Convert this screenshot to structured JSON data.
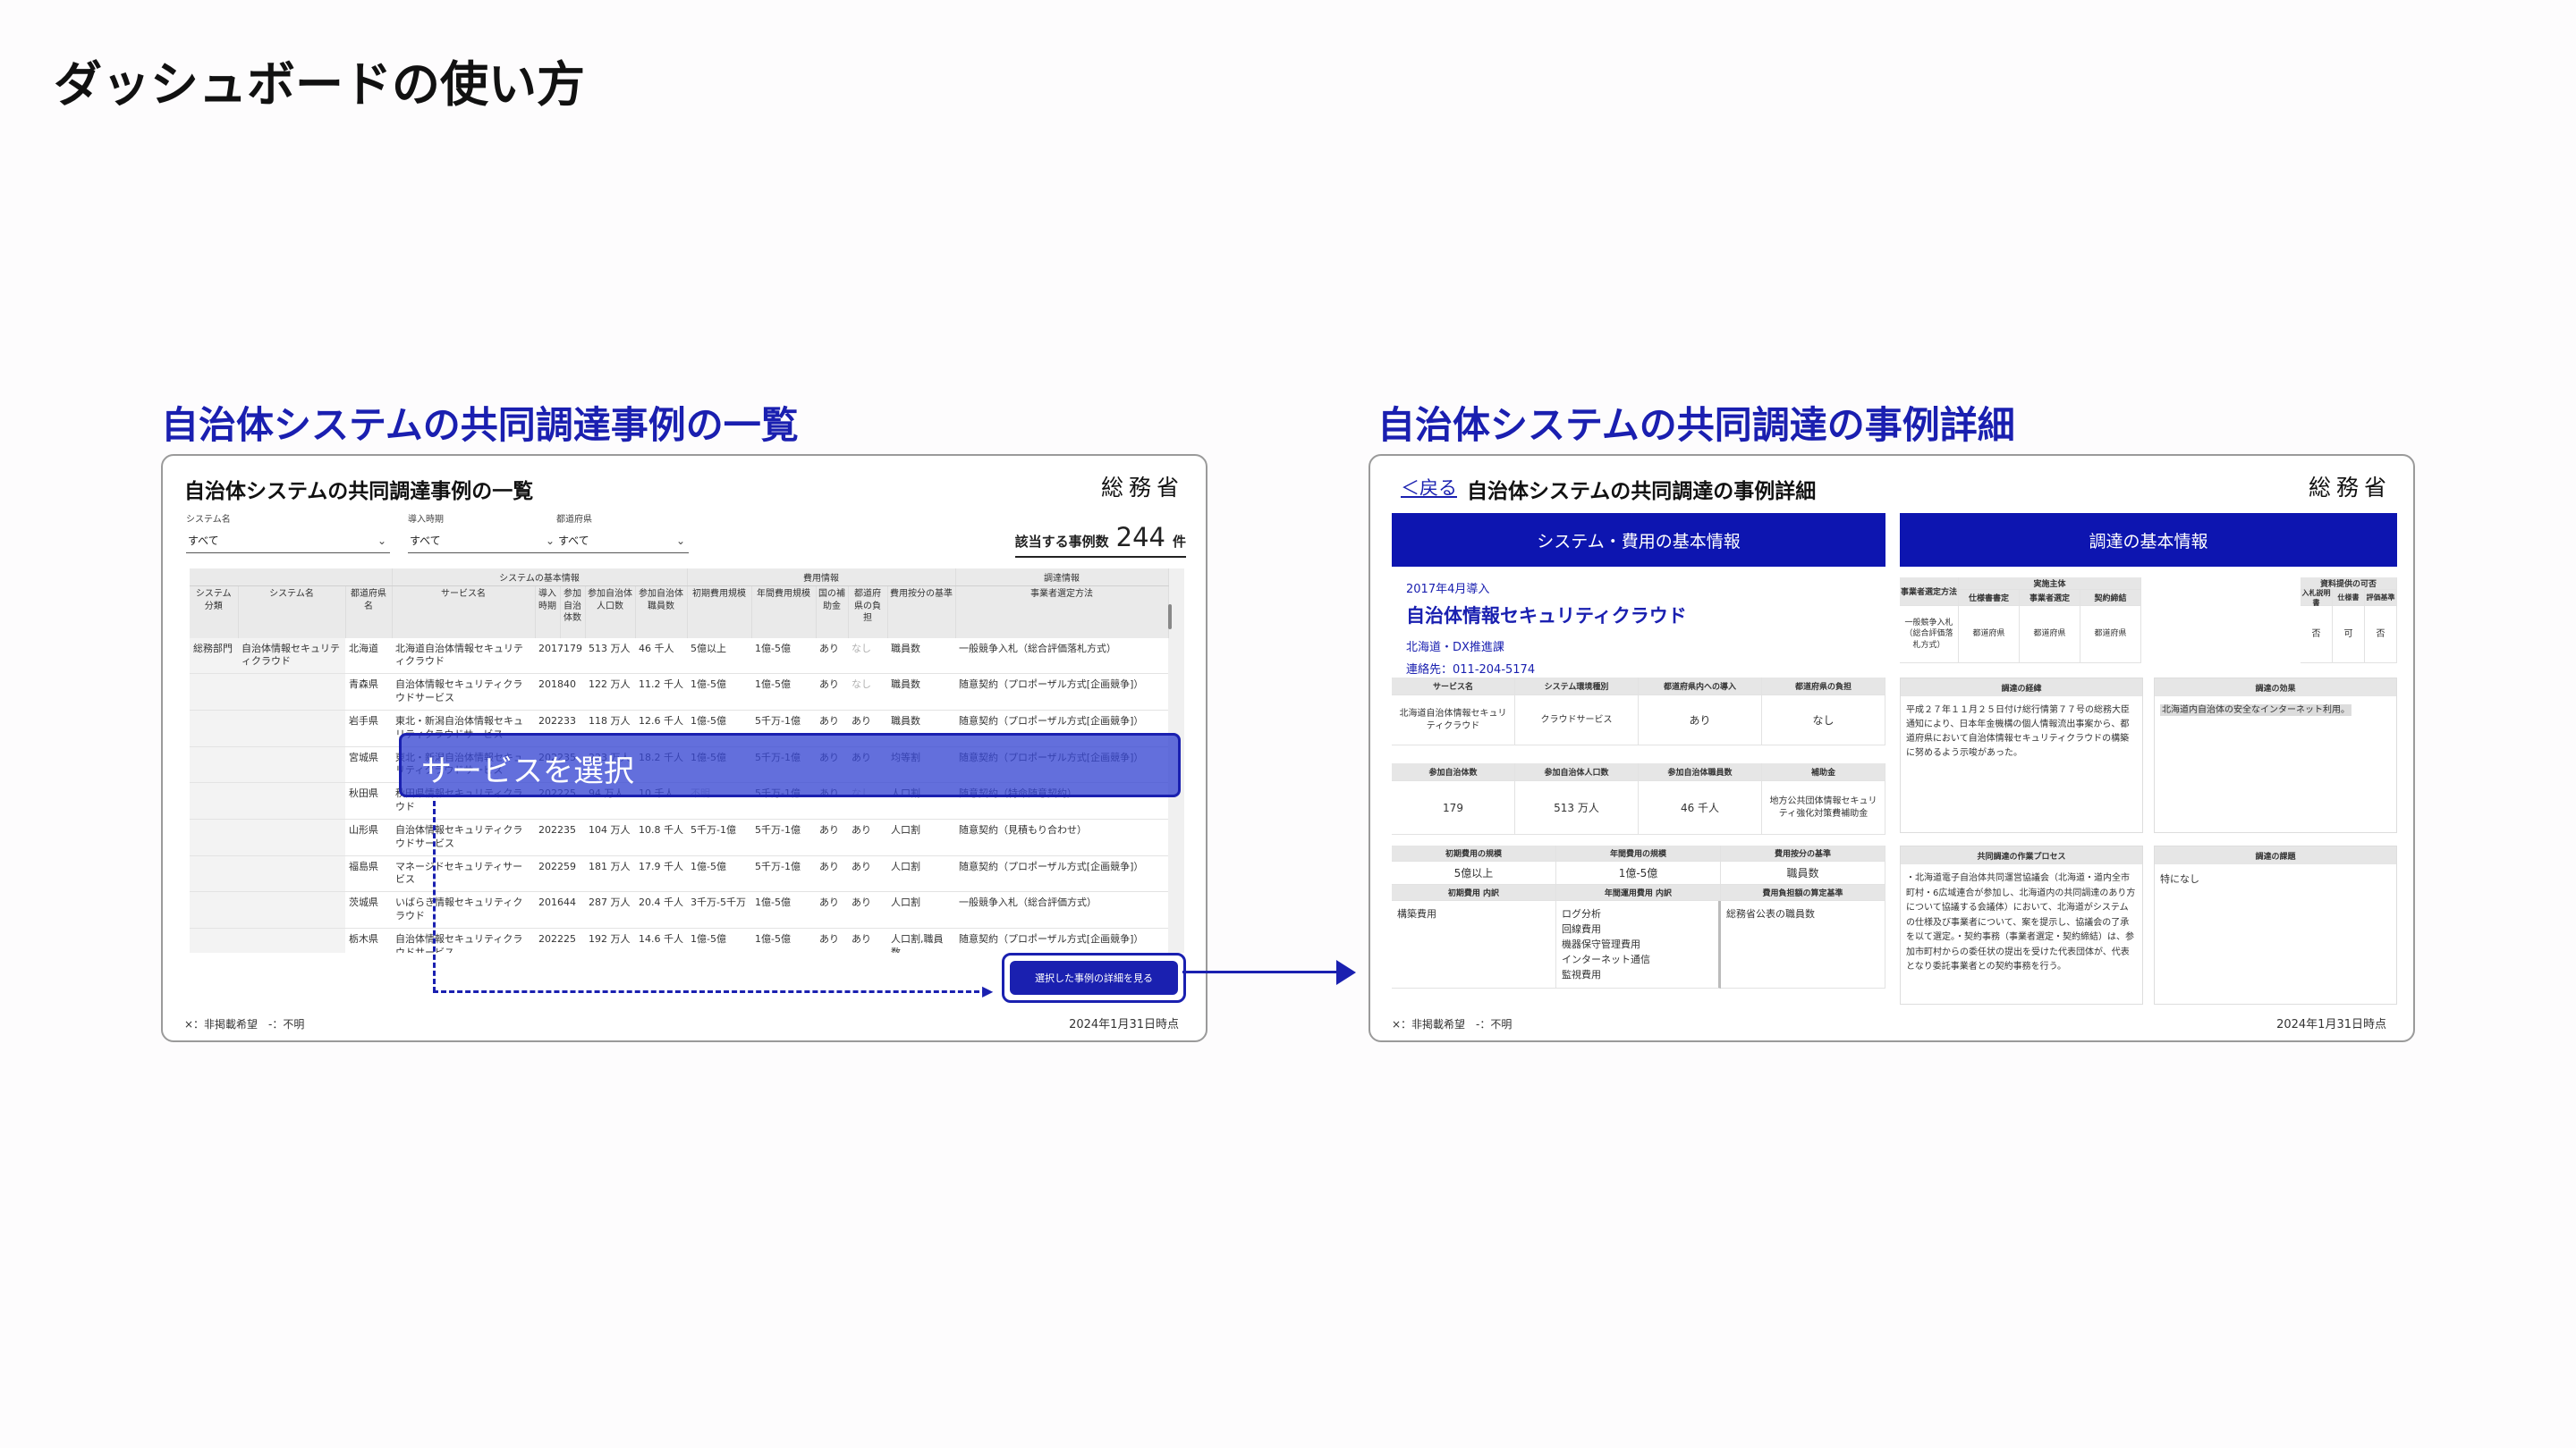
{
  "page_title": "ダッシュボードの使い方",
  "left_section_title": "自治体システムの共同調達事例の一覧",
  "right_section_title": "自治体システムの共同調達の事例詳細",
  "list_panel": {
    "title": "自治体システムの共同調達事例の一覧",
    "agency": "総務省",
    "filters": [
      {
        "label": "システム名",
        "value": "すべて"
      },
      {
        "label": "導入時期",
        "value": "すべて"
      },
      {
        "label": "都道府県",
        "value": "すべて"
      }
    ],
    "count_label": "該当する事例数",
    "count_value": "244",
    "count_unit": "件",
    "table": {
      "groups": [
        "",
        "システムの基本情報",
        "費用情報",
        "調達情報"
      ],
      "columns": [
        "システム分類",
        "システム名",
        "都道府県名",
        "サービス名",
        "導入時期",
        "参加自治体数",
        "参加自治体人口数",
        "参加自治体職員数",
        "初期費用規模",
        "年間費用規模",
        "国の補助金",
        "都道府県の負担",
        "費用按分の基準",
        "事業者選定方法"
      ],
      "rows": [
        [
          "総務部門",
          "自治体情報セキュリティクラウド",
          "北海道",
          "北海道自治体情報セキュリティクラウド",
          "2017",
          "179",
          "513 万人",
          "46 千人",
          "5億以上",
          "1億-5億",
          "あり",
          "なし",
          "職員数",
          "一般競争入札（総合評価落札方式）"
        ],
        [
          "",
          "",
          "青森県",
          "自治体情報セキュリティクラウドサービス",
          "2018",
          "40",
          "122 万人",
          "11.2 千人",
          "1億-5億",
          "1億-5億",
          "あり",
          "なし",
          "職員数",
          "随意契約（プロポーザル方式[企画競争]）"
        ],
        [
          "",
          "",
          "岩手県",
          "東北・新潟自治体情報セキュリティクラウドサービス",
          "2022",
          "33",
          "118 万人",
          "12.6 千人",
          "1億-5億",
          "5千万-1億",
          "あり",
          "あり",
          "職員数",
          "随意契約（プロポーザル方式[企画競争]）"
        ],
        [
          "",
          "",
          "宮城県",
          "東北・新潟自治体情報セキュリティクラウドサービス",
          "2022",
          "35",
          "223 万人",
          "18.2 千人",
          "1億-5億",
          "5千万-1億",
          "あり",
          "あり",
          "均等割",
          "随意契約（プロポーザル方式[企画競争]）"
        ],
        [
          "",
          "",
          "秋田県",
          "秋田県情報セキュリティクラウド",
          "2022",
          "25",
          "94 万人",
          "10 千人",
          "不明",
          "5千万-1億",
          "あり",
          "なし",
          "人口割",
          "随意契約（特命随意契約）"
        ],
        [
          "",
          "",
          "山形県",
          "自治体情報セキュリティクラウドサービス",
          "2022",
          "35",
          "104 万人",
          "10.8 千人",
          "5千万-1億",
          "5千万-1億",
          "あり",
          "あり",
          "人口割",
          "随意契約（見積もり合わせ）"
        ],
        [
          "",
          "",
          "福島県",
          "マネージドセキュリティサービス",
          "2022",
          "59",
          "181 万人",
          "17.9 千人",
          "1億-5億",
          "5千万-1億",
          "あり",
          "あり",
          "人口割",
          "随意契約（プロポーザル方式[企画競争]）"
        ],
        [
          "",
          "",
          "茨城県",
          "いばらき情報セキュリティクラウド",
          "2016",
          "44",
          "287 万人",
          "20.4 千人",
          "3千万-5千万",
          "1億-5億",
          "あり",
          "あり",
          "人口割",
          "一般競争入札（総合評価方式）"
        ],
        [
          "",
          "",
          "栃木県",
          "自治体情報セキュリティクラウドサービス",
          "2022",
          "25",
          "192 万人",
          "14.6 千人",
          "1億-5億",
          "1億-5億",
          "あり",
          "あり",
          "人口割,職員数",
          "随意契約（プロポーザル方式[企画競争]）"
        ]
      ]
    },
    "overlay_label": "サービスを選択",
    "detail_button": "選択した事例の詳細を見る",
    "footnote": "×：非掲載希望　-：不明",
    "as_of": "2024年1月31日時点"
  },
  "detail_panel": {
    "back": "＜戻る",
    "title": "自治体システムの共同調達の事例詳細",
    "agency": "総務省",
    "system_header": "システム・費用の基本情報",
    "procurement_header": "調達の基本情報",
    "intro_year": "2017年4月導入",
    "service_name": "自治体情報セキュリティクラウド",
    "department": "北海道・DX推進課",
    "contact": "連絡先：011-204-5174",
    "g1": {
      "heads": [
        "サービス名",
        "システム環境種別",
        "都道府県内への導入",
        "都道府県の負担"
      ],
      "vals": [
        "北海道自治体情報セキュリティクラウド",
        "クラウドサービス",
        "あり",
        "なし"
      ]
    },
    "g2": {
      "heads": [
        "参加自治体数",
        "参加自治体人口数",
        "参加自治体職員数",
        "補助金"
      ],
      "vals": [
        "179",
        "513 万人",
        "46 千人",
        "地方公共団体情報セキュリティ強化対策費補助金"
      ]
    },
    "g3": {
      "heads": [
        "初期費用の規模",
        "年間費用の規模",
        "費用按分の基準"
      ],
      "vals": [
        "5億以上",
        "1億-5億",
        "職員数"
      ],
      "sub_heads": [
        "初期費用 内訳",
        "年間運用費用 内訳",
        "費用負担額の算定基準"
      ],
      "initial_items": [
        "構築費用"
      ],
      "annual_items": [
        "ログ分析",
        "回線費用",
        "機器保守管理費用",
        "インターネット通信",
        "監視費用"
      ],
      "basis_items": [
        "総務省公表の職員数"
      ]
    },
    "proc_grid": {
      "method_head": "事業者選定方法",
      "actor_head": "実施主体",
      "actor_sub": [
        "仕様書書定",
        "事業者選定",
        "契約締結"
      ],
      "docs_head": "資料提供の可否",
      "docs_sub": [
        "入札説明書",
        "仕様書",
        "評価基準"
      ],
      "method_val": "一般競争入札（総合評価落札方式）",
      "actor_vals": [
        "都道府県",
        "都道府県",
        "都道府県"
      ],
      "docs_vals": [
        "否",
        "可",
        "否"
      ]
    },
    "background_head": "調達の経緯",
    "background_text": "平成２７年１１月２５日付け総行情第７７号の総務大臣通知により、日本年金機構の個人情報流出事案から、都道府県において自治体情報セキュリティクラウドの構築に努めるよう示唆があった。",
    "effect_head": "調達の効果",
    "effect_text": "北海道内自治体の安全なインターネット利用。",
    "process_head": "共同調達の作業プロセス",
    "process_text": "・北海道電子自治体共同運営協議会（北海道・道内全市町村・6広域連合が参加し、北海道内の共同調達のあり方について協議する会議体）において、北海道がシステムの仕様及び事業者について、案を提示し、協議会の了承を以て選定。・契約事務（事業者選定・契約締結）は、参加市町村からの委任状の提出を受けた代表団体が、代表となり委託事業者との契約事務を行う。",
    "issues_head": "調達の課題",
    "issues_text": "特になし",
    "footnote": "×：非掲載希望　-：不明",
    "as_of": "2024年1月31日時点"
  }
}
